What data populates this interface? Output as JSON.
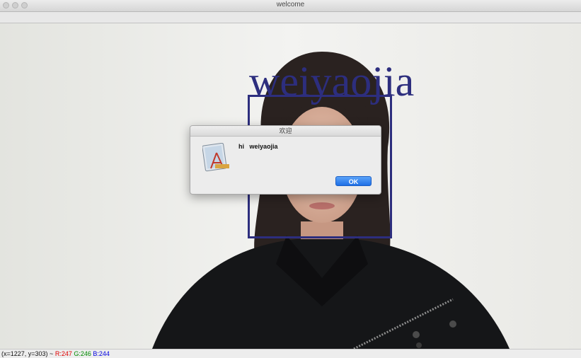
{
  "window": {
    "title": "welcome"
  },
  "overlay": {
    "name_text": "weiyaojia"
  },
  "dialog": {
    "title": "欢迎",
    "message": "hi   weiyaojia",
    "ok_label": "OK"
  },
  "status": {
    "coords": "(x=1227, y=303) ~",
    "r": "R:247",
    "g": "G:246",
    "b": "B:244"
  },
  "colors": {
    "overlay": "#2d2e7e",
    "ok_button": "#1f6fe6",
    "status_r": "#e00000",
    "status_g": "#008a00",
    "status_b": "#0000e0"
  },
  "icons": {
    "dialog_icon": "app-store-text-edit-icon"
  }
}
